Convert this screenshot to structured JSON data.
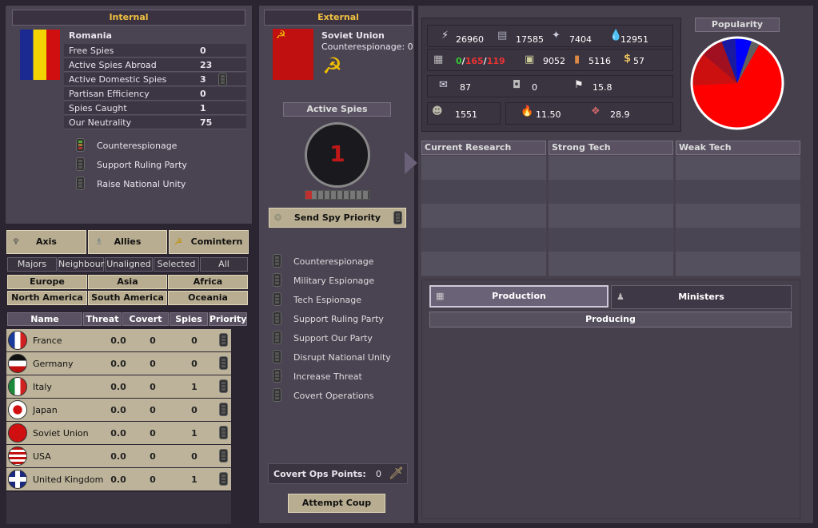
{
  "internal": {
    "header": "Internal",
    "country": "Romania",
    "stats": [
      {
        "label": "Free Spies",
        "value": "0"
      },
      {
        "label": "Active Spies Abroad",
        "value": "23"
      },
      {
        "label": "Active Domestic Spies",
        "value": "3"
      },
      {
        "label": "Partisan Efficiency",
        "value": "0"
      },
      {
        "label": "Spies Caught",
        "value": "1"
      },
      {
        "label": "Our Neutrality",
        "value": "75"
      }
    ],
    "missions": [
      "Counterespionage",
      "Support Ruling Party",
      "Raise National Unity"
    ]
  },
  "factions": [
    "Axis",
    "Allies",
    "Comintern"
  ],
  "filters": [
    "Majors",
    "Neighbours",
    "Unaligned",
    "Selected",
    "All"
  ],
  "regions": [
    "Europe",
    "Asia",
    "Africa",
    "North America",
    "South America",
    "Oceania"
  ],
  "table": {
    "headers": [
      "Name",
      "Threat",
      "Covert",
      "Spies",
      "Priority"
    ],
    "rows": [
      {
        "name": "France",
        "threat": "0.0",
        "covert": "0",
        "spies": "0"
      },
      {
        "name": "Germany",
        "threat": "0.0",
        "covert": "0",
        "spies": "0"
      },
      {
        "name": "Italy",
        "threat": "0.0",
        "covert": "0",
        "spies": "1"
      },
      {
        "name": "Japan",
        "threat": "0.0",
        "covert": "0",
        "spies": "0"
      },
      {
        "name": "Soviet Union",
        "threat": "0.0",
        "covert": "0",
        "spies": "1"
      },
      {
        "name": "USA",
        "threat": "0.0",
        "covert": "0",
        "spies": "0"
      },
      {
        "name": "United Kingdom",
        "threat": "0.0",
        "covert": "0",
        "spies": "1"
      }
    ]
  },
  "external": {
    "header": "External",
    "country": "Soviet Union",
    "counter": "Counterespionage: 0",
    "active_spies_label": "Active Spies",
    "active_spies_count": "1",
    "send_priority": "Send Spy Priority",
    "missions": [
      "Counterespionage",
      "Military Espionage",
      "Tech Espionage",
      "Support Ruling Party",
      "Support Our Party",
      "Disrupt National Unity",
      "Increase Threat",
      "Covert Operations"
    ],
    "covert_ops_label": "Covert Ops Points:",
    "covert_ops_value": "0",
    "coup": "Attempt Coup"
  },
  "resources": {
    "energy": "26960",
    "metal": "17585",
    "rare": "7404",
    "oil": "12951",
    "ic_a": "0",
    "ic_b": "165",
    "ic_c": "119",
    "supplies": "9052",
    "money": "5116",
    "cash": "57",
    "diplo": "87",
    "espionage": "0",
    "officers": "15.8",
    "manpower": "1551",
    "dissent": "11.50",
    "unity": "28.9"
  },
  "popularity": {
    "title": "Popularity",
    "slices": [
      {
        "color": "#ff0000",
        "share": 0.66
      },
      {
        "color": "#cc1010",
        "share": 0.12
      },
      {
        "color": "#a01020",
        "share": 0.08
      },
      {
        "color": "#1a1aa0",
        "share": 0.05
      },
      {
        "color": "#0000ff",
        "share": 0.06
      },
      {
        "color": "#606060",
        "share": 0.03
      }
    ]
  },
  "research": [
    "Current Research",
    "Strong Tech",
    "Weak Tech"
  ],
  "tabs": {
    "production": "Production",
    "ministers": "Ministers",
    "producing": "Producing"
  }
}
